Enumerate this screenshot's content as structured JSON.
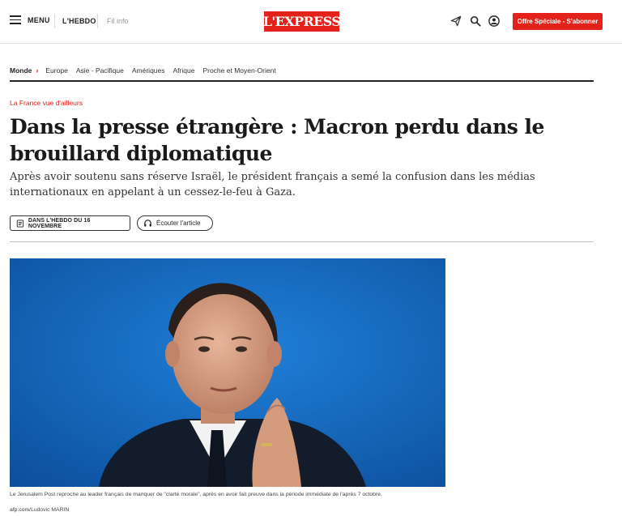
{
  "header": {
    "menu_label": "MENU",
    "hebdo_label": "L'HEBDO",
    "filinfo_label": "Fil info",
    "logo_text": "L'EXPRESS",
    "offer_button": "Offre Spéciale - S'abonner",
    "icons": [
      "send-icon",
      "search-icon",
      "account-icon"
    ],
    "brand_color": "#e3221b"
  },
  "section_nav": {
    "current": "Monde",
    "items": [
      "Europe",
      "Asie - Pacifique",
      "Amériques",
      "Afrique",
      "Proche et Moyen-Orient"
    ]
  },
  "article": {
    "kicker": "La France vue d'ailleurs",
    "headline": "Dans la presse étrangère : Macron perdu dans le brouillard diplomatique",
    "standfirst": "Après avoir soutenu sans réserve Israël, le président français a semé la confusion dans les médias internationaux en appelant à un cessez-le-feu à Gaza.",
    "hebdo_badge": "DANS L'HEBDO DU 16 NOVEMBRE",
    "listen_button": "Écouter l'article",
    "caption": "Le Jerusalem Post reproche au leader français de manquer de \"clarté morale\", après en avoir fait preuve dans la période immédiate de l'après 7 octobre.",
    "credit": "afp.com/Ludovic MARIN"
  }
}
